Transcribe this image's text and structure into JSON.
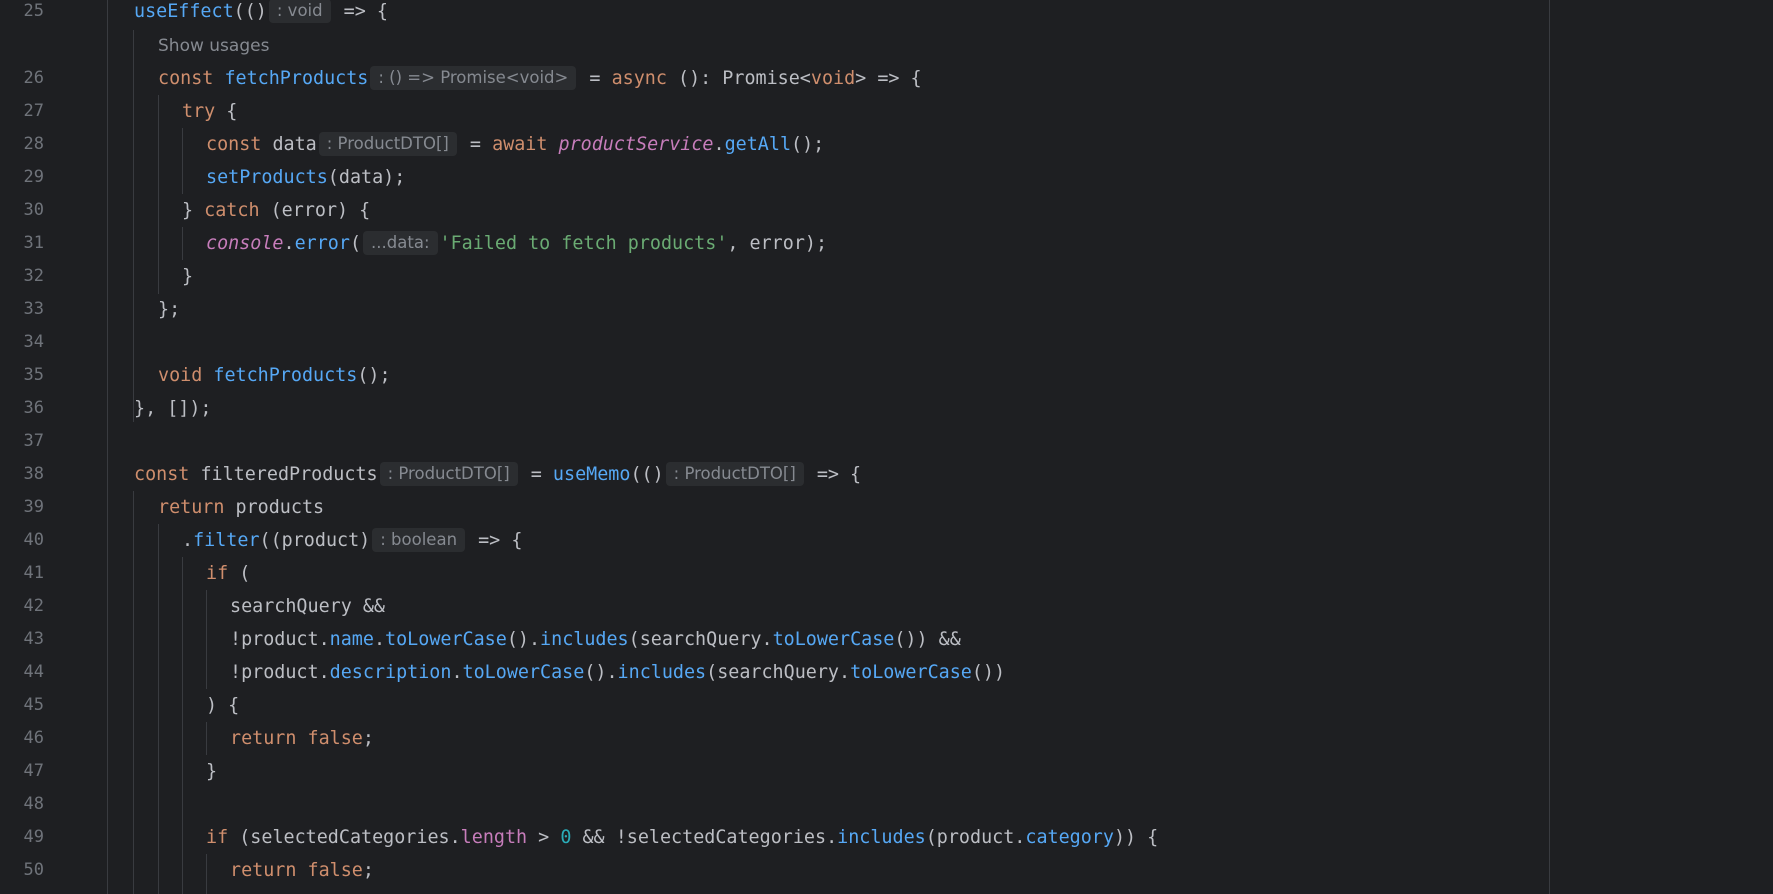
{
  "editor": {
    "line_numbers": [
      "25",
      "26",
      "27",
      "28",
      "29",
      "30",
      "31",
      "32",
      "33",
      "34",
      "35",
      "36",
      "37",
      "38",
      "39",
      "40",
      "41",
      "42",
      "43",
      "44",
      "45",
      "46",
      "47",
      "48",
      "49",
      "50"
    ],
    "usages_hint": "Show usages",
    "tokens": {
      "l25": [
        "useEffect",
        "(()",
        ": void",
        " => {"
      ],
      "l26": [
        "const ",
        "fetchProducts",
        ": () => Promise<void>",
        " = ",
        "async",
        " (): Promise<",
        "void",
        "> => {"
      ],
      "l27": [
        "try",
        " {"
      ],
      "l28": [
        "const ",
        "data",
        ": ProductDTO[]",
        " = ",
        "await ",
        "productService",
        ".",
        "getAll",
        "();"
      ],
      "l29": [
        "setProducts",
        "(data);"
      ],
      "l30": [
        "} ",
        "catch",
        " (error) {"
      ],
      "l31": [
        "console",
        ".",
        "error",
        "(",
        "...data:",
        "'Failed to fetch products'",
        ", error);"
      ],
      "l32": [
        "}"
      ],
      "l33": [
        "};"
      ],
      "l35": [
        "void ",
        "fetchProducts",
        "();"
      ],
      "l36": [
        "}, []);"
      ],
      "l38": [
        "const ",
        "filteredProducts",
        ": ProductDTO[]",
        " = ",
        "useMemo",
        "(()",
        ": ProductDTO[]",
        " => {"
      ],
      "l39": [
        "return ",
        "products"
      ],
      "l40": [
        ".",
        "filter",
        "((product)",
        ": boolean",
        " => {"
      ],
      "l41": [
        "if",
        " ("
      ],
      "l42": [
        "searchQuery &&"
      ],
      "l43": [
        "!product.",
        "name",
        ".",
        "toLowerCase",
        "().",
        "includes",
        "(searchQuery.",
        "toLowerCase",
        "()) &&"
      ],
      "l44": [
        "!product.",
        "description",
        ".",
        "toLowerCase",
        "().",
        "includes",
        "(searchQuery.",
        "toLowerCase",
        "())"
      ],
      "l45": [
        ") {"
      ],
      "l46": [
        "return ",
        "false",
        ";"
      ],
      "l47": [
        "}"
      ],
      "l49": [
        "if",
        " (selectedCategories.",
        "length",
        " > ",
        "0",
        " && !selectedCategories.",
        "includes",
        "(product.",
        "category",
        ")) {"
      ],
      "l50": [
        "return ",
        "false",
        ";"
      ]
    },
    "colors": {
      "background": "#1e1f22",
      "keyword": "#cf8e6d",
      "function": "#56a8f5",
      "string": "#6aab73",
      "number": "#2aacb8",
      "global": "#c77dbb",
      "text": "#bcbec4",
      "inlay_hint_bg": "#2b2d30"
    }
  }
}
